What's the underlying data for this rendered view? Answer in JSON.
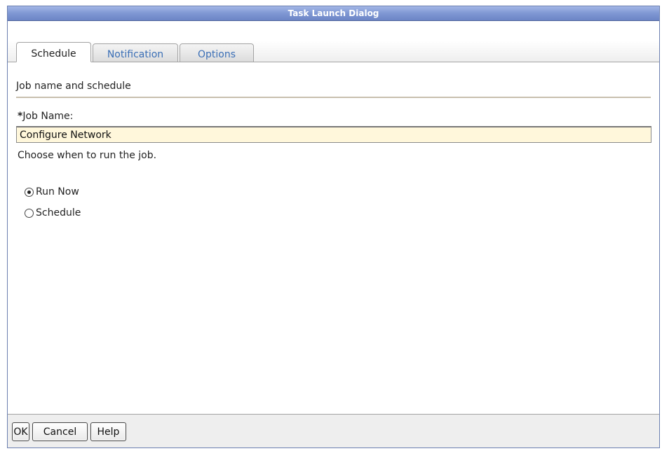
{
  "window": {
    "title": "Task Launch Dialog"
  },
  "tabs": [
    {
      "label": "Schedule",
      "active": true
    },
    {
      "label": "Notification",
      "active": false
    },
    {
      "label": "Options",
      "active": false
    }
  ],
  "section": {
    "title": "Job name and schedule"
  },
  "job_name": {
    "required_marker": "*",
    "label": "Job Name:",
    "value": "Configure Network"
  },
  "schedule_hint": "Choose when to run the job.",
  "run_options": [
    {
      "label": "Run Now",
      "checked": true
    },
    {
      "label": "Schedule",
      "checked": false
    }
  ],
  "buttons": {
    "ok": "OK",
    "cancel": "Cancel",
    "help": "Help"
  },
  "icons": {
    "required": "asterisk-icon"
  },
  "colors": {
    "titlebar": "#7f97d3",
    "tab_link": "#3b6fb6",
    "input_bg": "#fff7db",
    "rule": "#c8bfae"
  }
}
